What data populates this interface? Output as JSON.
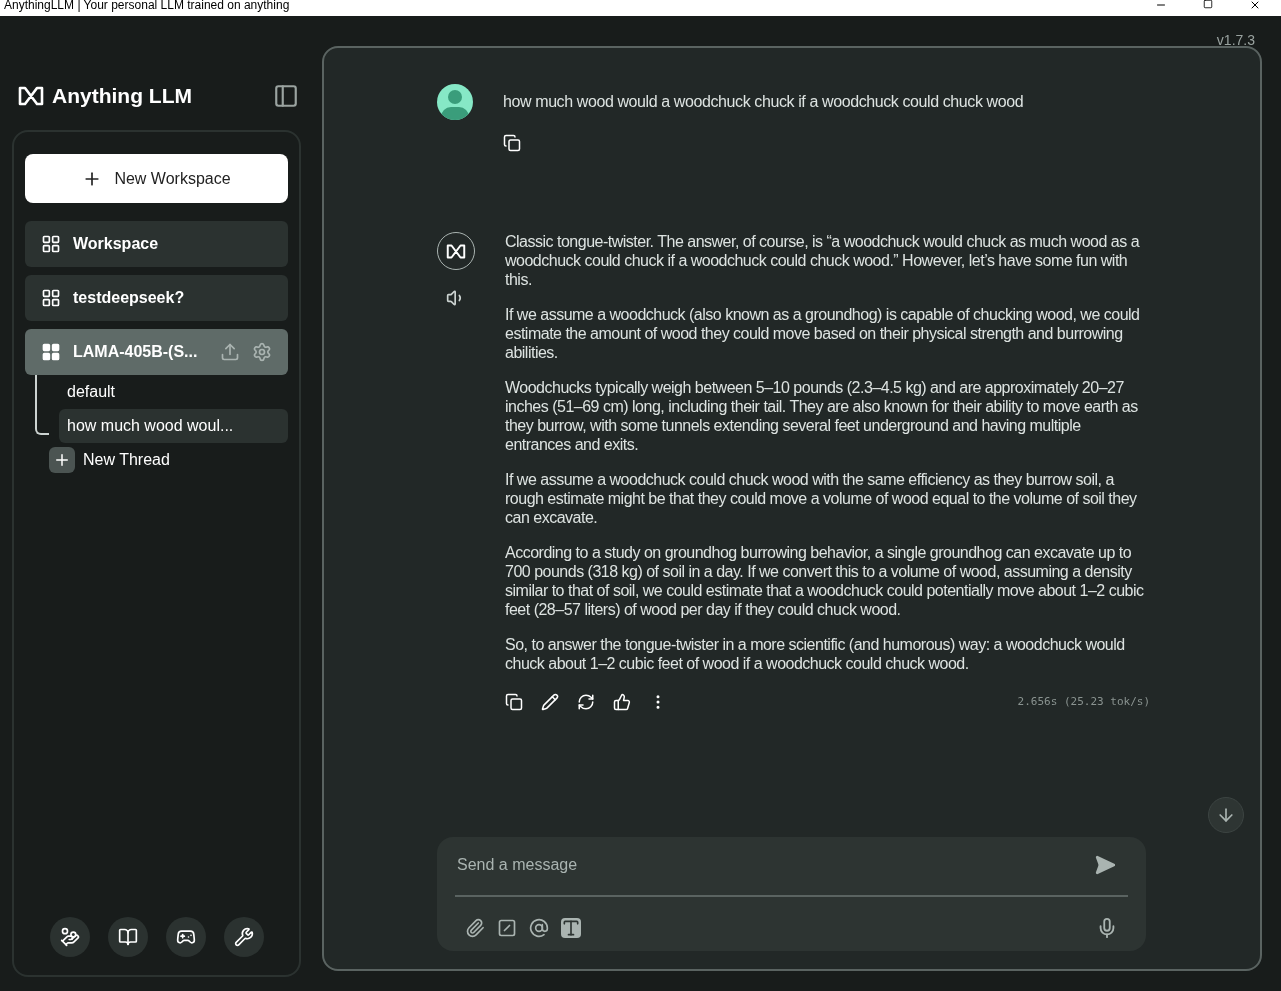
{
  "window": {
    "title": "AnythingLLM | Your personal LLM trained on anything"
  },
  "version": "v1.7.3",
  "sidebar": {
    "brand": "Anything LLM",
    "new_workspace": "New Workspace",
    "workspaces": [
      {
        "name": "Workspace",
        "selected": false
      },
      {
        "name": "testdeepseek?",
        "selected": false
      },
      {
        "name": "LAMA-405B-(S...",
        "selected": true,
        "threads": [
          {
            "name": "default",
            "selected": false
          },
          {
            "name": "how much wood woul...",
            "selected": true
          }
        ],
        "new_thread": "New Thread"
      }
    ]
  },
  "chat": {
    "messages": [
      {
        "kind": "user",
        "text": "how much wood would a woodchuck chuck if a woodchuck could chuck wood"
      },
      {
        "kind": "assistant",
        "paragraphs": [
          "Classic tongue-twister. The answer, of course, is “a woodchuck would chuck as much wood as a woodchuck could chuck if a woodchuck could chuck wood.” However, let’s have some fun with this.",
          "If we assume a woodchuck (also known as a groundhog) is capable of chucking wood, we could estimate the amount of wood they could move based on their physical strength and burrowing abilities.",
          "Woodchucks typically weigh between 5–10 pounds (2.3–4.5 kg) and are approximately 20–27 inches (51–69 cm) long, including their tail. They are also known for their ability to move earth as they burrow, with some tunnels extending several feet underground and having multiple entrances and exits.",
          "If we assume a woodchuck could chuck wood with the same efficiency as they burrow soil, a rough estimate might be that they could move a volume of wood equal to the volume of soil they can excavate.",
          "According to a study on groundhog burrowing behavior, a single groundhog can excavate up to 700 pounds (318 kg) of soil in a day. If we convert this to a volume of wood, assuming a density similar to that of soil, we could estimate that a woodchuck could potentially move about 1–2 cubic feet (28–57 liters) of wood per day if they could chuck wood.",
          "So, to answer the tongue-twister in a more scientific (and humorous) way: a woodchuck would chuck about 1–2 cubic feet of wood if a woodchuck could chuck wood."
        ],
        "stats": "2.656s (25.23 tok/s)"
      }
    ]
  },
  "composer": {
    "placeholder": "Send a message"
  }
}
